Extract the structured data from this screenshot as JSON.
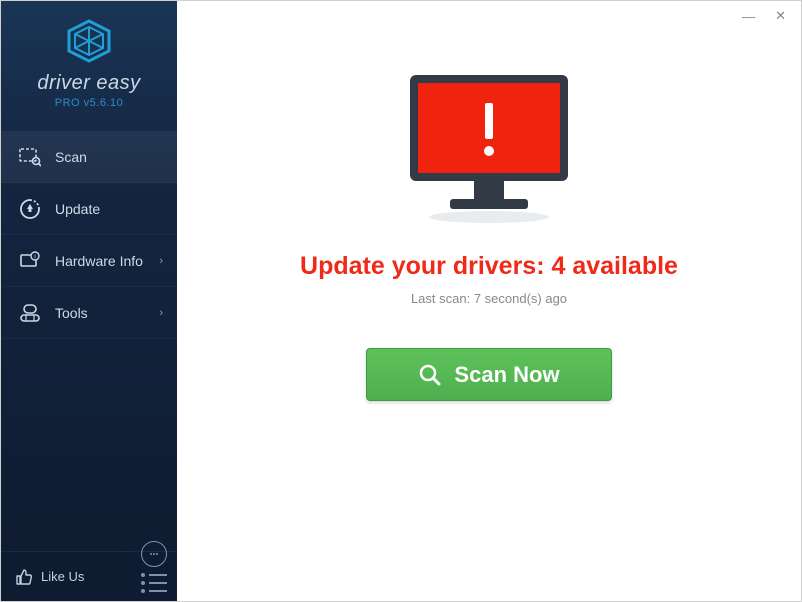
{
  "brand": {
    "name": "driver easy",
    "version_label": "PRO v5.6.10"
  },
  "sidebar": {
    "items": [
      {
        "label": "Scan",
        "has_chevron": false,
        "active": true
      },
      {
        "label": "Update",
        "has_chevron": false,
        "active": false
      },
      {
        "label": "Hardware Info",
        "has_chevron": true,
        "active": false
      },
      {
        "label": "Tools",
        "has_chevron": true,
        "active": false
      }
    ],
    "like_label": "Like Us"
  },
  "main": {
    "headline": "Update your drivers: 4 available",
    "sub_prefix": "Last scan: ",
    "sub_value": "7 second(s) ago",
    "scan_button": "Scan Now"
  },
  "window": {
    "minimize": "—",
    "close": "✕"
  }
}
